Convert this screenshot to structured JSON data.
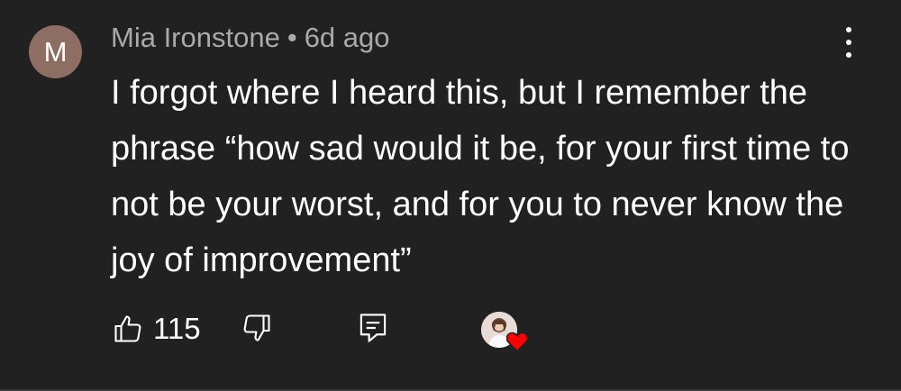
{
  "author": {
    "initial": "M",
    "name": "Mia Ironstone",
    "separator": "•",
    "timestamp": "6d ago",
    "avatar_color": "#8d6e63"
  },
  "comment": {
    "text": "I forgot where I heard this, but I remember the phrase “how sad would it be, for your first time to not be your worst, and for you to never know the joy of improvement”"
  },
  "actions": {
    "like_icon": "thumbs-up-icon",
    "like_count": "115",
    "dislike_icon": "thumbs-down-icon",
    "reply_icon": "reply-icon",
    "hearted_by_creator": true,
    "heart_color": "#ff0000"
  },
  "menu": {
    "icon": "more-vert-icon"
  }
}
